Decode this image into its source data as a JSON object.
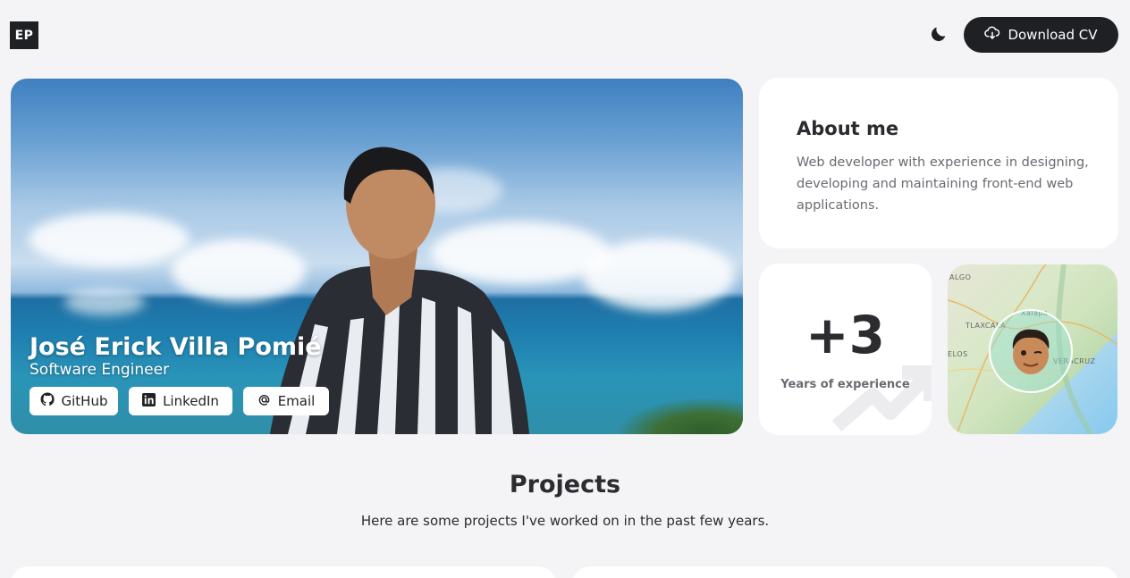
{
  "header": {
    "logo": "EP",
    "theme_icon": "moon-icon",
    "download_icon": "cloud-download-icon",
    "download_label": "Download CV"
  },
  "hero": {
    "name": "José Erick Villa Pomié",
    "role": "Software Engineer",
    "links": [
      {
        "label": "GitHub",
        "icon": "github-icon"
      },
      {
        "label": "LinkedIn",
        "icon": "linkedin-icon"
      },
      {
        "label": "Email",
        "icon": "at-icon"
      }
    ]
  },
  "about": {
    "title": "About me",
    "text": "Web developer with experience in designing, developing and maintaining front-end web applications."
  },
  "experience": {
    "value": "+3",
    "label": "Years of experience"
  },
  "map": {
    "labels": [
      "ALGO",
      "Xalapa",
      "TLAXCALA",
      "VERACRUZ",
      "ELOS"
    ]
  },
  "projects": {
    "title": "Projects",
    "subtitle": "Here are some projects I've worked on in the past few years."
  },
  "colors": {
    "dark": "#1f2024",
    "background": "#f4f4f6",
    "card": "#ffffff"
  }
}
